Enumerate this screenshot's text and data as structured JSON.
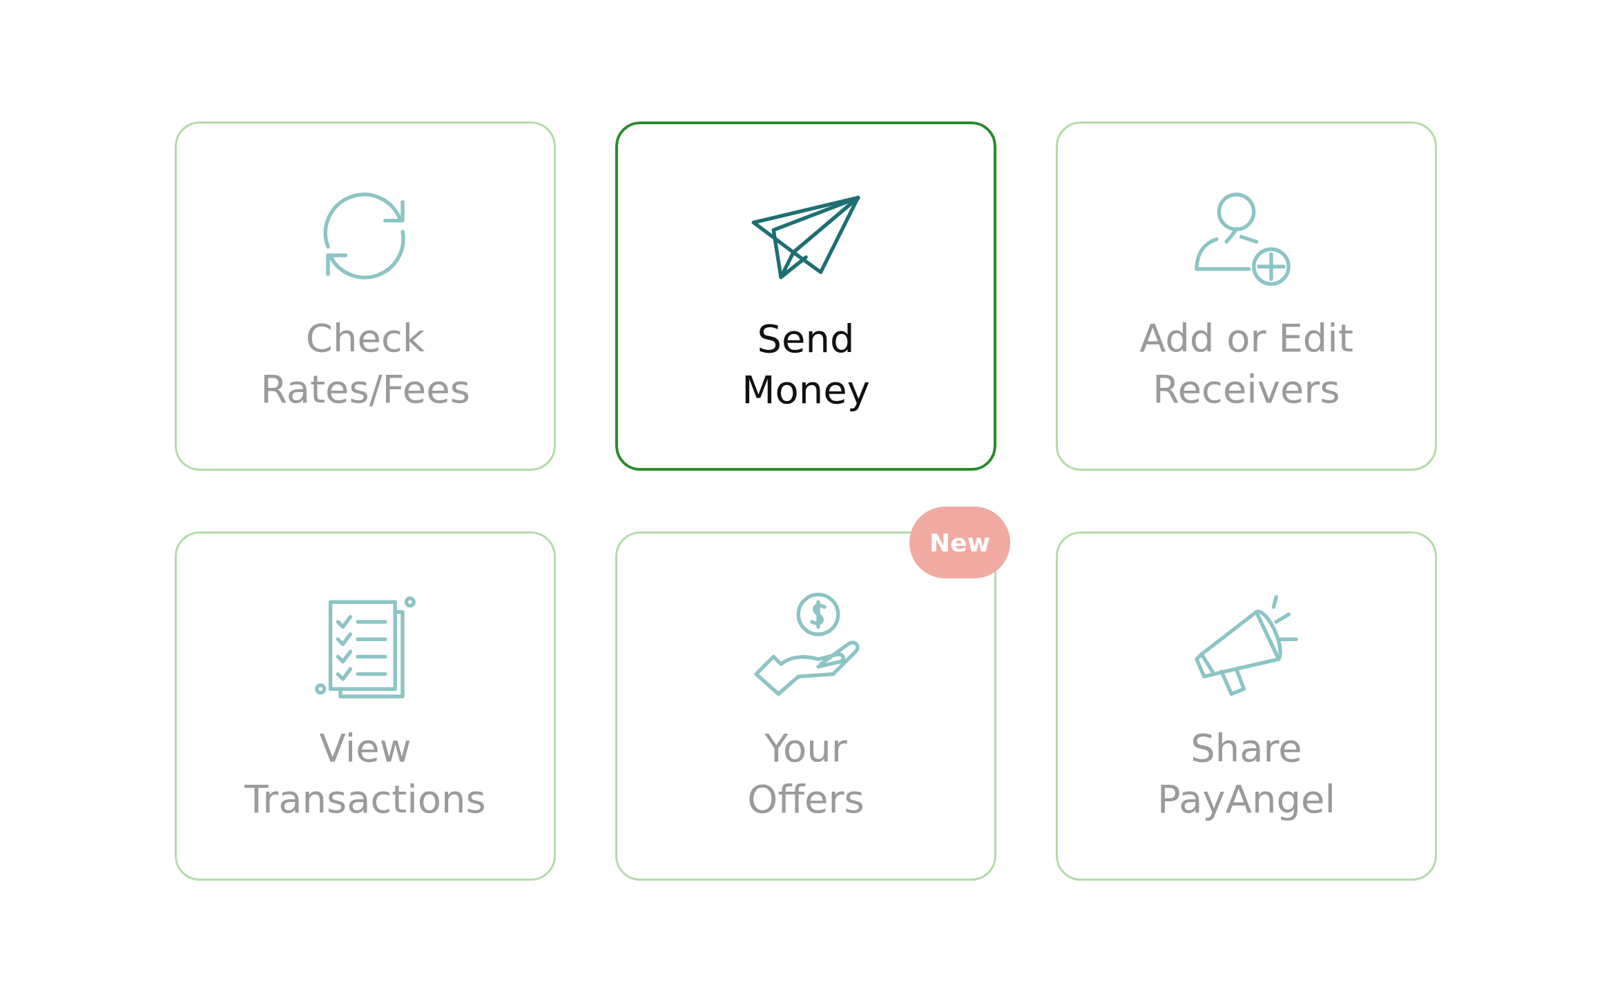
{
  "tiles": [
    {
      "lines": [
        "Check",
        "Rates/Fees"
      ],
      "selected": false
    },
    {
      "lines": [
        "Send",
        "Money"
      ],
      "selected": true
    },
    {
      "lines": [
        "Add or Edit",
        "Receivers"
      ],
      "selected": false
    },
    {
      "lines": [
        "View",
        "Transactions"
      ],
      "selected": false
    },
    {
      "lines": [
        "Your",
        "Offers"
      ],
      "selected": false,
      "badge": "New"
    },
    {
      "lines": [
        "Share",
        "PayAngel"
      ],
      "selected": false
    }
  ]
}
